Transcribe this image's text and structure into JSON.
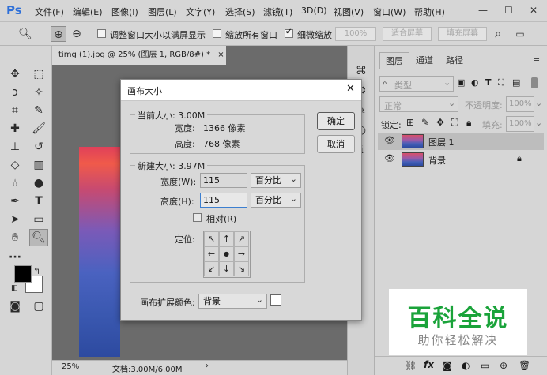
{
  "app": {
    "logo": "Ps",
    "menu": [
      "文件(F)",
      "编辑(E)",
      "图像(I)",
      "图层(L)",
      "文字(Y)",
      "选择(S)",
      "滤镜(T)",
      "3D(D)",
      "视图(V)",
      "窗口(W)",
      "帮助(H)"
    ],
    "window_controls": {
      "minimize": "—",
      "maximize": "☐",
      "close": "✕"
    }
  },
  "options_bar": {
    "resize_windows_label": "调整窗口大小以满屏显示",
    "resize_windows_checked": false,
    "zoom_all_label": "缩放所有窗口",
    "zoom_all_checked": false,
    "scrubby_zoom_label": "细微缩放",
    "scrubby_zoom_checked": true,
    "btn_100": "100%",
    "btn_fit": "适合屏幕",
    "btn_fill": "填充屏幕"
  },
  "document": {
    "tab_title": "timg (1).jpg @ 25% (图层 1, RGB/8#) *",
    "tab_close": "×",
    "zoom": "25%",
    "doc_info": "文档:3.00M/6.00M"
  },
  "layers_panel": {
    "tabs": [
      "图层",
      "通道",
      "路径"
    ],
    "filter_kind": "类型",
    "blend_mode": "正常",
    "opacity_label": "不透明度:",
    "opacity_value": "100%",
    "lock_label": "锁定:",
    "fill_label": "填充:",
    "fill_value": "100%",
    "layers": [
      {
        "name": "图层 1",
        "selected": true
      },
      {
        "name": "背景",
        "selected": false,
        "locked": true
      }
    ],
    "bottom_icons": [
      "link-icon",
      "fx-icon",
      "mask-icon",
      "adjustment-icon",
      "folder-icon",
      "new-layer-icon",
      "trash-icon"
    ]
  },
  "dialog": {
    "title": "画布大小",
    "close": "✕",
    "current_size_legend": "当前大小: 3.00M",
    "current_width_label": "宽度:",
    "current_width_value": "1366 像素",
    "current_height_label": "高度:",
    "current_height_value": "768 像素",
    "new_size_legend": "新建大小: 3.97M",
    "width_label": "宽度(W):",
    "width_value": "115",
    "width_unit": "百分比",
    "height_label": "高度(H):",
    "height_value": "115",
    "height_unit": "百分比",
    "relative_label": "相对(R)",
    "relative_checked": false,
    "anchor_label": "定位:",
    "anchor_arrows": [
      "↖",
      "↑",
      "↗",
      "←",
      "●",
      "→",
      "↙",
      "↓",
      "↘"
    ],
    "extension_color_label": "画布扩展颜色:",
    "extension_color_value": "背景",
    "ok_button": "确定",
    "cancel_button": "取消",
    "swatch_color": "#ffffff"
  },
  "watermark": {
    "title": "百科全说",
    "subtitle": "助你轻松解决",
    "title_color": "#1aa33a"
  },
  "colors": {
    "accent": "#2d6fd8",
    "foreground": "#000000",
    "background": "#ffffff"
  }
}
